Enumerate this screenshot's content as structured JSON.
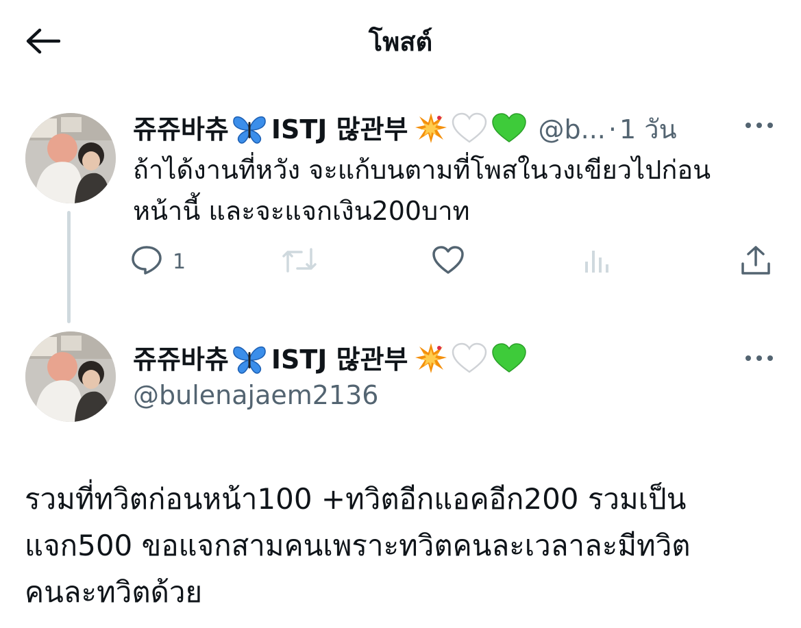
{
  "header": {
    "title": "โพสต์"
  },
  "parent_tweet": {
    "display_name": "쥬쥬바츄",
    "name_suffix": "ISTJ 많관부",
    "handle": "@b...",
    "separator": "·",
    "time": "1 วัน",
    "text_line1": "ถ้าได้งานที่หวัง จะแก้บนตามที่โพสในวงเขียวไปก่อน",
    "text_line2": "หน้านี้ และจะแจกเงิน200บาท",
    "actions": {
      "reply_count": "1"
    }
  },
  "main_tweet": {
    "display_name": "쥬쥬바츄",
    "name_suffix": "ISTJ 많관부",
    "handle": "@bulenajaem2136",
    "text_line1": "รวมที่ทวิตก่อนหน้า100 +ทวิตอีกแอคอีก200 รวมเป็น",
    "text_line2": "แจก500 ขอแจกสามคนเพราะทวิตคนละเวลาละมีทวิต",
    "text_line3": "คนละทวิตด้วย"
  },
  "colors": {
    "text": "#0f1419",
    "secondary": "#536471",
    "thread_line": "#cfd9de",
    "butterfly": "#3b8eea",
    "green_heart": "#3ecb3a"
  },
  "icons": [
    "back-arrow-icon",
    "more-icon",
    "reply-icon",
    "repost-icon",
    "like-icon",
    "views-icon",
    "share-icon",
    "butterfly-emoji",
    "collision-emoji",
    "white-heart-emoji",
    "green-heart-emoji"
  ]
}
